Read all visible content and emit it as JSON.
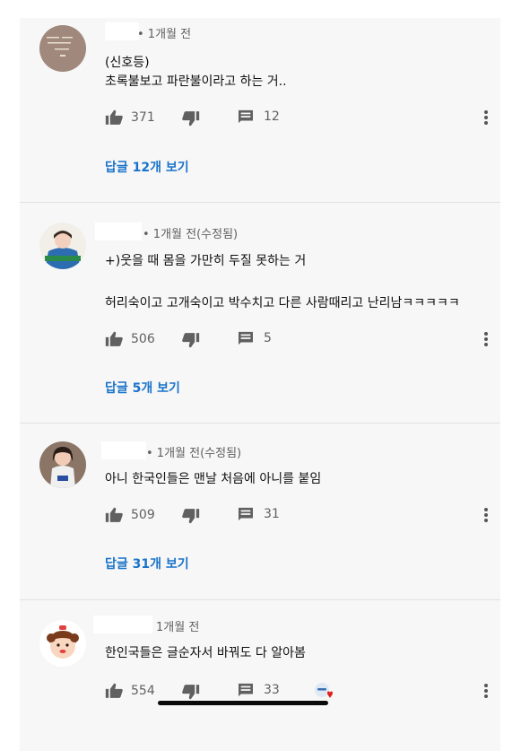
{
  "colors": {
    "background": "#f7f7f7",
    "link": "#1a73c9",
    "meta": "#606060",
    "text": "#0f0f0f"
  },
  "comments": [
    {
      "avatar_icon": "profile-text-avatar-icon",
      "meta": "• 1개월 전",
      "lines": [
        "(신호등)",
        "초록불보고 파란불이라고 하는 거.."
      ],
      "likes": "371",
      "replies_count": "12",
      "view_replies": "답글 12개 보기"
    },
    {
      "avatar_icon": "profile-photo-avatar-icon",
      "meta": "• 1개월 전(수정됨)",
      "lines": [
        "+)웃을 때 몸을 가만히 두질 못하는 거",
        "허리숙이고 고개숙이고 박수치고 다른 사람때리고 난리남ㅋㅋㅋㅋㅋ"
      ],
      "likes": "506",
      "replies_count": "5",
      "view_replies": "답글 5개 보기"
    },
    {
      "avatar_icon": "profile-photo-avatar-icon",
      "meta": "• 1개월 전(수정됨)",
      "lines": [
        "아니 한국인들은 맨날 처음에 아니를 붙임"
      ],
      "likes": "509",
      "replies_count": "31",
      "view_replies": "답글 31개 보기"
    },
    {
      "avatar_icon": "cartoon-girl-avatar-icon",
      "meta": "1개월 전",
      "lines": [
        "한인국들은 글순자서 바꿔도 다 알아봄"
      ],
      "likes": "554",
      "replies_count": "33",
      "view_replies": ""
    }
  ],
  "icons": {
    "like": "thumbs-up-icon",
    "dislike": "thumbs-down-icon",
    "reply": "comment-icon",
    "more": "more-vert-icon",
    "creator_heart": "creator-heart-icon"
  }
}
